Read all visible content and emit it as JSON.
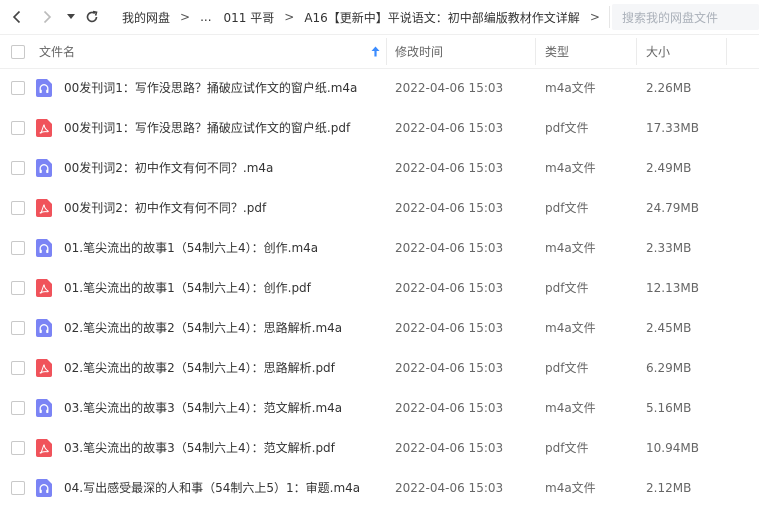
{
  "breadcrumbs": {
    "items": [
      "我的网盘",
      "...",
      "011 平哥",
      "A16【更新中】平说语文：初中部编版教材作文详解"
    ]
  },
  "search": {
    "placeholder": "搜索我的网盘文件"
  },
  "table": {
    "headers": {
      "name": "文件名",
      "modified": "修改时间",
      "type": "类型",
      "size": "大小"
    },
    "rows": [
      {
        "name": "00发刊词1：写作没思路？捅破应试作文的窗户纸.m4a",
        "modified": "2022-04-06 15:03",
        "type": "m4a文件",
        "size": "2.26MB",
        "icon": "audio-file-icon"
      },
      {
        "name": "00发刊词1：写作没思路？捅破应试作文的窗户纸.pdf",
        "modified": "2022-04-06 15:03",
        "type": "pdf文件",
        "size": "17.33MB",
        "icon": "pdf-file-icon"
      },
      {
        "name": "00发刊词2：初中作文有何不同？.m4a",
        "modified": "2022-04-06 15:03",
        "type": "m4a文件",
        "size": "2.49MB",
        "icon": "audio-file-icon"
      },
      {
        "name": "00发刊词2：初中作文有何不同？.pdf",
        "modified": "2022-04-06 15:03",
        "type": "pdf文件",
        "size": "24.79MB",
        "icon": "pdf-file-icon"
      },
      {
        "name": "01.笔尖流出的故事1（54制六上4）：创作.m4a",
        "modified": "2022-04-06 15:03",
        "type": "m4a文件",
        "size": "2.33MB",
        "icon": "audio-file-icon"
      },
      {
        "name": "01.笔尖流出的故事1（54制六上4）：创作.pdf",
        "modified": "2022-04-06 15:03",
        "type": "pdf文件",
        "size": "12.13MB",
        "icon": "pdf-file-icon"
      },
      {
        "name": "02.笔尖流出的故事2（54制六上4）：思路解析.m4a",
        "modified": "2022-04-06 15:03",
        "type": "m4a文件",
        "size": "2.45MB",
        "icon": "audio-file-icon"
      },
      {
        "name": "02.笔尖流出的故事2（54制六上4）：思路解析.pdf",
        "modified": "2022-04-06 15:03",
        "type": "pdf文件",
        "size": "6.29MB",
        "icon": "pdf-file-icon"
      },
      {
        "name": "03.笔尖流出的故事3（54制六上4）：范文解析.m4a",
        "modified": "2022-04-06 15:03",
        "type": "m4a文件",
        "size": "5.16MB",
        "icon": "audio-file-icon"
      },
      {
        "name": "03.笔尖流出的故事3（54制六上4）：范文解析.pdf",
        "modified": "2022-04-06 15:03",
        "type": "pdf文件",
        "size": "10.94MB",
        "icon": "pdf-file-icon"
      },
      {
        "name": "04.写出感受最深的人和事（54制六上5）1：审题.m4a",
        "modified": "2022-04-06 15:03",
        "type": "m4a文件",
        "size": "2.12MB",
        "icon": "audio-file-icon"
      }
    ]
  },
  "colors": {
    "audio_icon": "#7b84f5",
    "pdf_icon": "#f0535b",
    "sort_arrow": "#3b8cff"
  }
}
